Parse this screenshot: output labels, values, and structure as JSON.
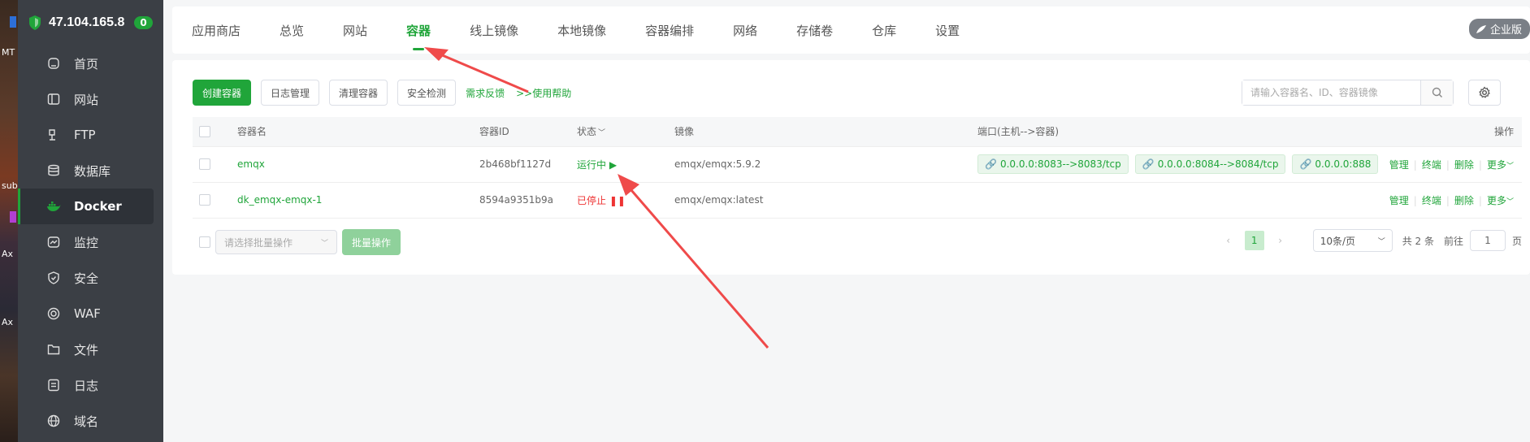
{
  "desktop": {
    "labels": [
      "MT",
      "sub",
      "Ax",
      "Ax"
    ]
  },
  "sidebar": {
    "ip": "47.104.165.8",
    "badge": "0",
    "items": [
      {
        "label": "首页",
        "icon": "home-icon"
      },
      {
        "label": "网站",
        "icon": "website-icon"
      },
      {
        "label": "FTP",
        "icon": "ftp-icon"
      },
      {
        "label": "数据库",
        "icon": "database-icon"
      },
      {
        "label": "Docker",
        "icon": "docker-icon",
        "active": true
      },
      {
        "label": "监控",
        "icon": "monitor-icon"
      },
      {
        "label": "安全",
        "icon": "shield-icon"
      },
      {
        "label": "WAF",
        "icon": "waf-icon"
      },
      {
        "label": "文件",
        "icon": "folder-icon"
      },
      {
        "label": "日志",
        "icon": "log-icon"
      },
      {
        "label": "域名",
        "icon": "globe-icon"
      }
    ]
  },
  "topnav": {
    "tabs": [
      "应用商店",
      "总览",
      "网站",
      "容器",
      "线上镜像",
      "本地镜像",
      "容器编排",
      "网络",
      "存储卷",
      "仓库",
      "设置"
    ],
    "active_tab": "容器",
    "enterprise": "企业版"
  },
  "toolbar": {
    "create": "创建容器",
    "logs": "日志管理",
    "clean": "清理容器",
    "security": "安全检测",
    "feedback": "需求反馈",
    "help": ">>使用帮助",
    "search_placeholder": "请输入容器名、ID、容器镜像"
  },
  "table": {
    "headers": {
      "name": "容器名",
      "id": "容器ID",
      "status": "状态",
      "image": "镜像",
      "ports": "端口(主机-->容器)",
      "ops": "操作"
    },
    "rows": [
      {
        "name": "emqx",
        "id": "2b468bf1127d",
        "status": "运行中",
        "status_type": "running",
        "image": "emqx/emqx:5.9.2",
        "ports": [
          "0.0.0.0:8083-->8083/tcp",
          "0.0.0.0:8084-->8084/tcp",
          "0.0.0.0:888"
        ]
      },
      {
        "name": "dk_emqx-emqx-1",
        "id": "8594a9351b9a",
        "status": "已停止",
        "status_type": "stopped",
        "image": "emqx/emqx:latest",
        "ports": []
      }
    ],
    "ops": [
      "管理",
      "终端",
      "删除",
      "更多"
    ]
  },
  "footer": {
    "batch_placeholder": "请选择批量操作",
    "batch_button": "批量操作",
    "page": "1",
    "page_size": "10条/页",
    "total": "共 2 条",
    "goto": "前往",
    "goto_value": "1",
    "page_unit": "页"
  },
  "colors": {
    "accent": "#20a53a",
    "sidebar": "#3b3f45",
    "stopped": "#e33333",
    "arrow": "#ef4a4a"
  }
}
